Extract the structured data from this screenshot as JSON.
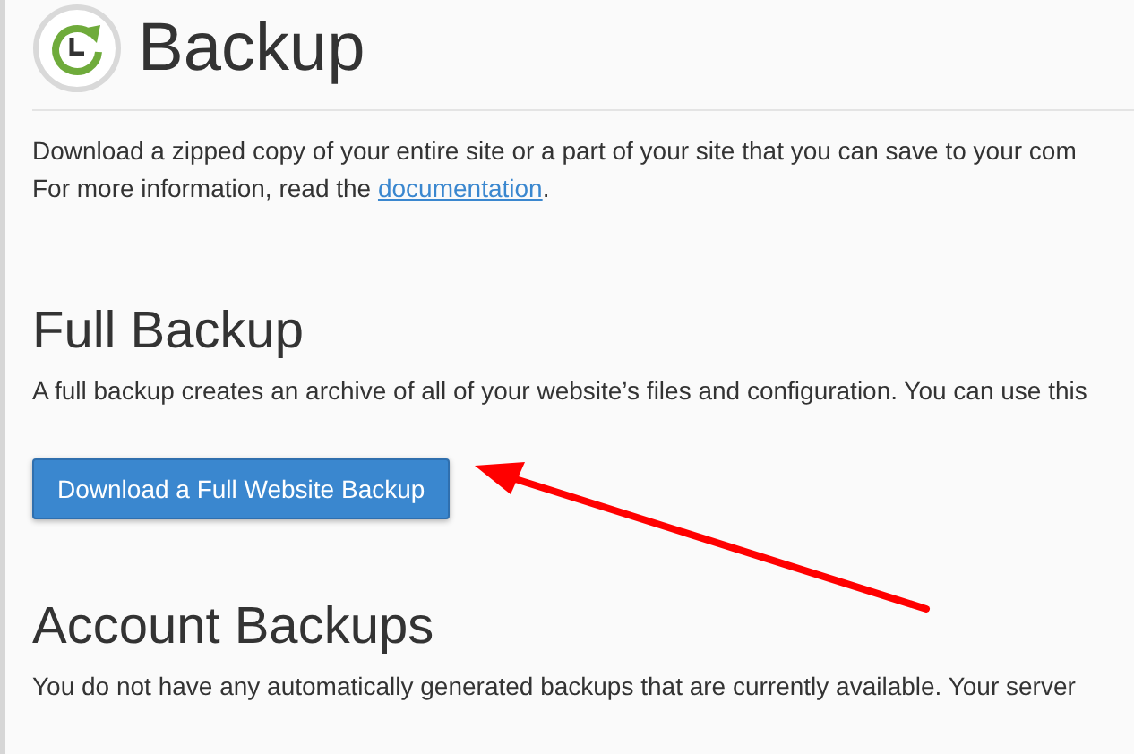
{
  "page": {
    "title": "Backup",
    "intro": [
      "Download a zipped copy of your entire site or a part of your site that you can save to your com"
    ],
    "more_info": {
      "text": "For more information, read the ",
      "link": "documentation",
      "after": "."
    }
  },
  "sections": [
    {
      "kind": "button",
      "heading": "Full Backup",
      "text": "A full backup creates an archive of all of your website’s files and configuration. You can use this",
      "button": "Download a Full Website Backup"
    },
    {
      "kind": "text",
      "heading": "Account Backups",
      "text": "You do not have any automatically generated backups that are currently available. Your server"
    }
  ]
}
